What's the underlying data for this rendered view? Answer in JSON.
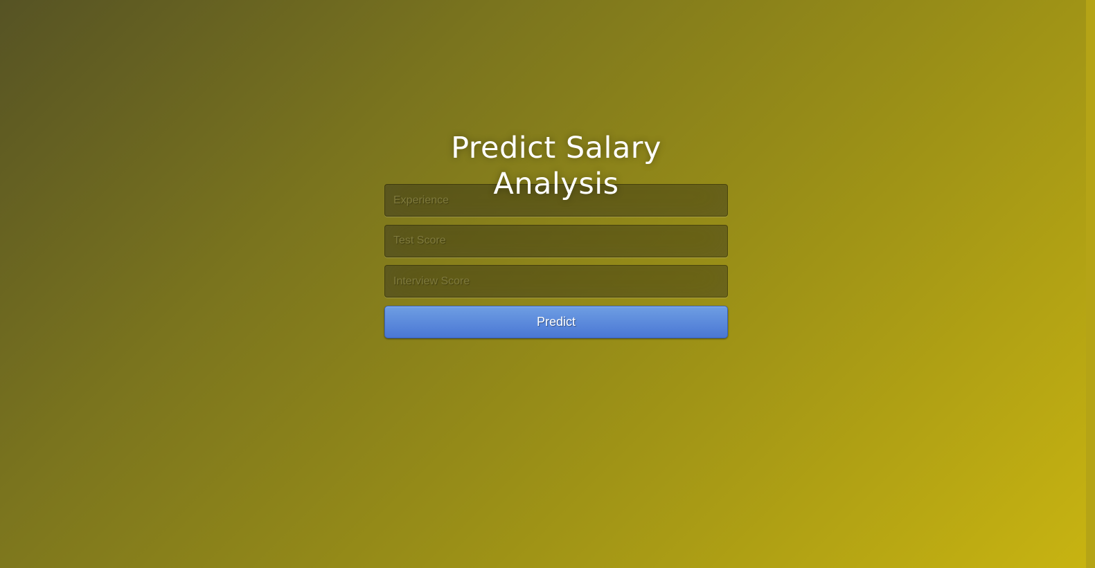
{
  "page": {
    "title": "Predict Salary Analysis"
  },
  "form": {
    "experience": {
      "placeholder": "Experience",
      "value": ""
    },
    "test_score": {
      "placeholder": "Test Score",
      "value": ""
    },
    "interview_score": {
      "placeholder": "Interview Score",
      "value": ""
    },
    "submit_label": "Predict"
  },
  "colors": {
    "background_start": "#565324",
    "background_end": "#c8b411",
    "button": "#4a77d4",
    "title": "#ffffff"
  }
}
